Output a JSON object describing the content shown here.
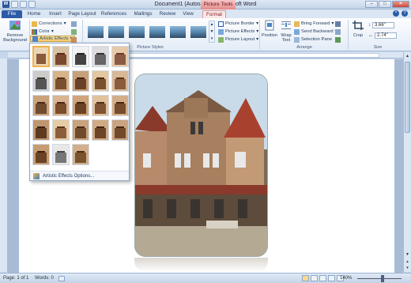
{
  "window": {
    "title": "Document1 (Autosaved) - Microsoft Word",
    "context_tab": "Picture Tools",
    "word_icon": "W"
  },
  "tabs": [
    "File",
    "Home",
    "Insert",
    "Page Layout",
    "References",
    "Mailings",
    "Review",
    "View",
    "Format"
  ],
  "active_tab": "Format",
  "ribbon": {
    "remove_background": "Remove Background",
    "corrections": "Corrections",
    "color": "Color",
    "artistic_effects": "Artistic Effects",
    "picture_styles_label": "Picture Styles",
    "picture_border": "Picture Border",
    "picture_effects": "Picture Effects",
    "picture_layout": "Picture Layout",
    "position": "Position",
    "wrap_text": "Wrap Text",
    "bring_forward": "Bring Forward",
    "send_backward": "Send Backward",
    "selection_pane": "Selection Pane",
    "arrange_label": "Arrange",
    "crop": "Crop",
    "height": "3.66\"",
    "width": "2.74\"",
    "size_label": "Size"
  },
  "artistic_menu": {
    "options_label": "Artistic Effects Options...",
    "effects_count": 23
  },
  "status": {
    "page": "Page: 1 of 1",
    "words": "Words: 0",
    "zoom": "140%"
  },
  "colors": {
    "accent": "#2a5ca8",
    "context": "#e48a8a",
    "selection": "#f1b24a"
  }
}
